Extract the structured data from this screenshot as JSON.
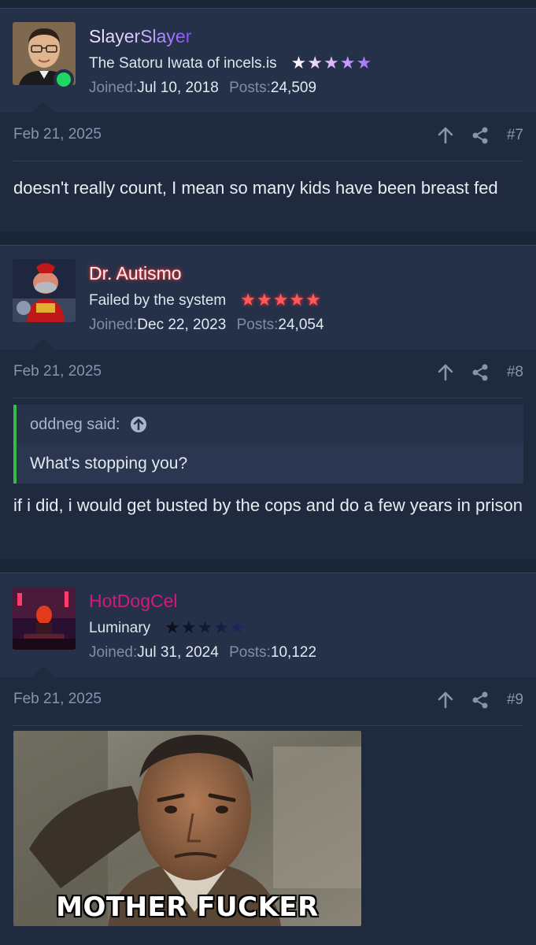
{
  "posts": [
    {
      "username": "SlayerSlayer",
      "user_title": "The Satoru Iwata of incels.is",
      "stars": "★★★★★",
      "joined_label": "Joined:",
      "joined": "Jul 10, 2018",
      "posts_label": "Posts:",
      "post_count": "24,509",
      "online": true,
      "date": "Feb 21, 2025",
      "number": "#7",
      "body": "doesn't really count, I mean so many kids have been breast fed"
    },
    {
      "username": "Dr. Autismo",
      "user_title": "Failed by the system",
      "stars": "★★★★★",
      "joined_label": "Joined:",
      "joined": "Dec 22, 2023",
      "posts_label": "Posts:",
      "post_count": "24,054",
      "date": "Feb 21, 2025",
      "number": "#8",
      "quote": {
        "author": "oddneg said:",
        "text": "What's stopping you?"
      },
      "body": "if i did, i would get busted by the cops and do a few years in prison"
    },
    {
      "username": "HotDogCel",
      "user_title": "Luminary",
      "stars": "★★★★★",
      "joined_label": "Joined:",
      "joined": "Jul 31, 2024",
      "posts_label": "Posts:",
      "post_count": "10,122",
      "date": "Feb 21, 2025",
      "number": "#9",
      "media_caption": "MOTHER FUCKER"
    }
  ],
  "colors": {
    "page_bg": "#1b2538",
    "user_block_bg": "#253149",
    "message_bg": "#1f2a3f",
    "slayer_name": "#9b5cff",
    "autismo_name": "#ff6a6a",
    "hotdog_name": "#d6177e",
    "online": "#1ed760",
    "quote_border": "#3bb84d"
  },
  "icons": [
    "arrow-up-icon",
    "share-icon",
    "quote-arrow-icon",
    "online-status-icon"
  ]
}
